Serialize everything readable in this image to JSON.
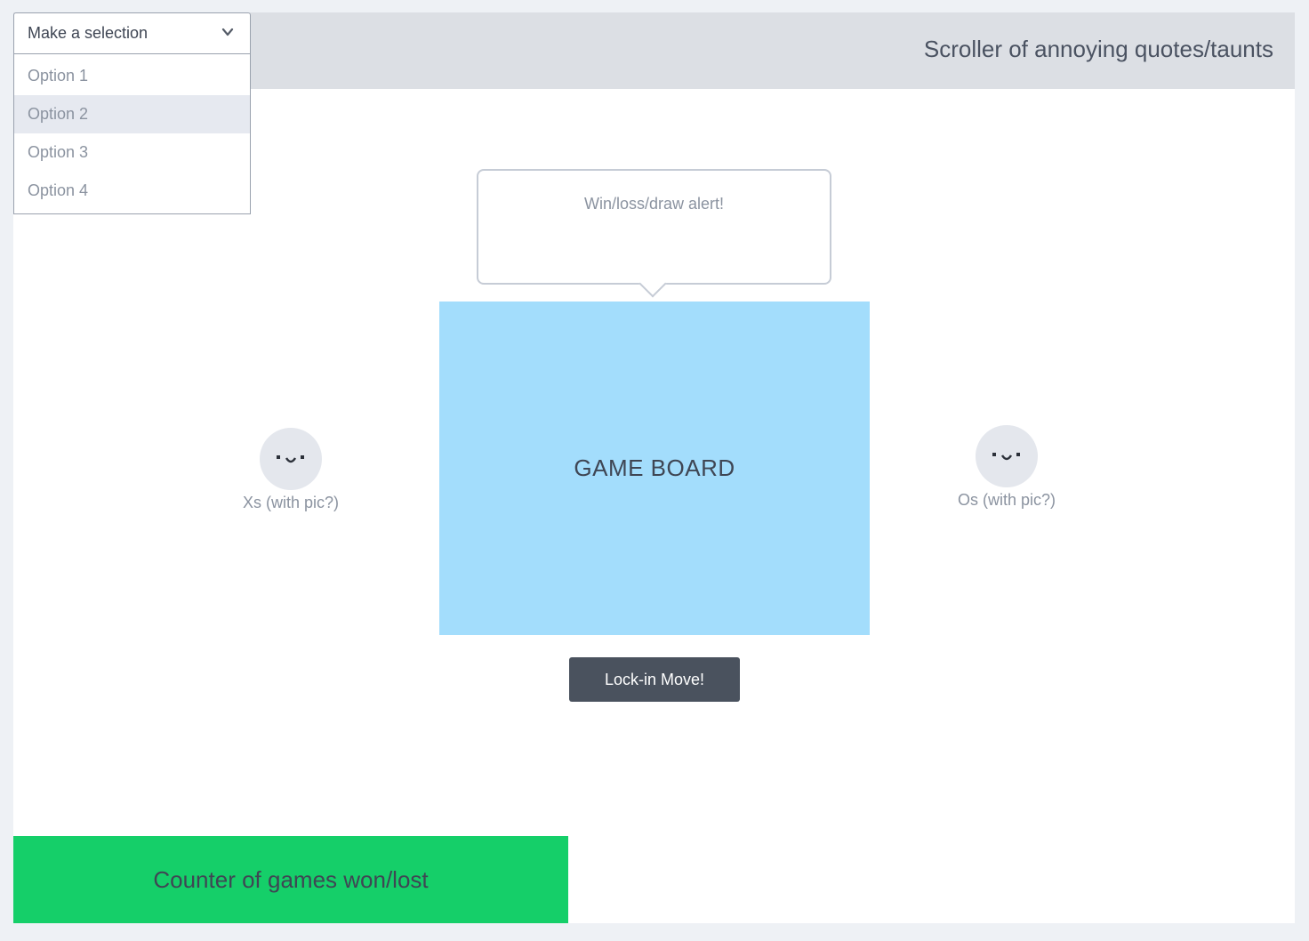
{
  "header": {
    "title": "Scroller of annoying quotes/taunts"
  },
  "dropdown": {
    "selected_label": "Make a selection",
    "chevron_icon": "chevron-down-icon",
    "options": [
      "Option 1",
      "Option 2",
      "Option 3",
      "Option 4"
    ],
    "highlighted_option": "Option 2"
  },
  "alert": {
    "text": "Win/loss/draw alert!"
  },
  "board": {
    "label": "GAME BOARD",
    "color": "#a3ddfc"
  },
  "players": {
    "x": {
      "label": "Xs (with pic?)",
      "avatar_icon": "smiley-face-icon"
    },
    "o": {
      "label": "Os (with pic?)",
      "avatar_icon": "smiley-face-icon"
    }
  },
  "actions": {
    "lock_in_label": "Lock-in Move!"
  },
  "counter": {
    "label": "Counter of games won/lost",
    "color": "#15cf69"
  }
}
